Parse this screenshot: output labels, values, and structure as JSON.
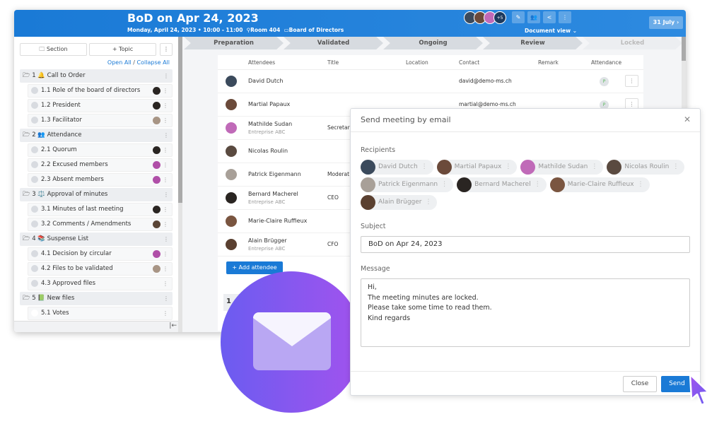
{
  "header": {
    "title": "BoD on Apr 24, 2023",
    "datetime": "Monday, April 24, 2023 • 10:00 - 11:00",
    "location": "Room 404",
    "group": "Board of Directors",
    "more_count": "+5",
    "document_view": "Document view",
    "next_date": "31 July",
    "avatar_colors": [
      "#3b4a5c",
      "#6b4a3a",
      "#c06ab8"
    ]
  },
  "sidebar": {
    "section_btn": "Section",
    "topic_btn": "+ Topic",
    "open_all": "Open All",
    "collapse_all": "Collapse All",
    "sections": [
      {
        "label": "1 🔔 Call to Order",
        "items": [
          {
            "label": "1.1 Role of the board of directors",
            "av": "#2a2522"
          },
          {
            "label": "1.2 President",
            "av": "#2a2522"
          },
          {
            "label": "1.3 Facilitator",
            "av": "#a89585"
          }
        ]
      },
      {
        "label": "2 👥 Attendance",
        "items": [
          {
            "label": "2.1 Quorum",
            "av": "#2a2522"
          },
          {
            "label": "2.2 Excused members",
            "av": "#b04fa8"
          },
          {
            "label": "2.3 Absent members",
            "av": "#b04fa8"
          }
        ]
      },
      {
        "label": "3 ⚖️ Approval of minutes",
        "items": [
          {
            "label": "3.1 Minutes of last meeting",
            "av": "#2a2522"
          },
          {
            "label": "3.2 Comments / Amendments",
            "av": "#5a4536"
          }
        ]
      },
      {
        "label": "4 📚 Suspense List",
        "items": [
          {
            "label": "4.1 Decision by circular",
            "av": "#b04fa8"
          },
          {
            "label": "4.2 Files to be validated",
            "av": "#a89585"
          },
          {
            "label": "4.3 Approved files",
            "av": ""
          }
        ]
      },
      {
        "label": "5 📗 New files",
        "items": [
          {
            "label": "5.1 Votes",
            "av": ""
          }
        ]
      }
    ]
  },
  "stepper": [
    "Preparation",
    "Validated",
    "Ongoing",
    "Review",
    "Locked"
  ],
  "table": {
    "headers": [
      "Attendees",
      "Title",
      "Location",
      "Contact",
      "Remark",
      "Attendance"
    ],
    "rows": [
      {
        "name": "David Dutch",
        "company": "",
        "title": "",
        "contact": "david@demo-ms.ch",
        "attendance": "P",
        "av": "#3b4a5c"
      },
      {
        "name": "Martial Papaux",
        "company": "",
        "title": "",
        "contact": "martial@demo-ms.ch",
        "attendance": "P",
        "av": "#6b4a3a"
      },
      {
        "name": "Mathilde Sudan",
        "company": "Entreprise ABC",
        "title": "Secretar",
        "contact": "",
        "attendance": "",
        "av": "#c06ab8"
      },
      {
        "name": "Nicolas Roulin",
        "company": "",
        "title": "",
        "contact": "",
        "attendance": "",
        "av": "#5a4a40"
      },
      {
        "name": "Patrick Eigenmann",
        "company": "",
        "title": "Moderat",
        "contact": "",
        "attendance": "",
        "av": "#a8a098"
      },
      {
        "name": "Bernard Macherel",
        "company": "Entreprise ABC",
        "title": "CEO",
        "contact": "",
        "attendance": "",
        "av": "#2a2522"
      },
      {
        "name": "Marie-Claire Ruffieux",
        "company": "",
        "title": "",
        "contact": "",
        "attendance": "",
        "av": "#7a5540"
      },
      {
        "name": "Alain Brügger",
        "company": "Entreprise ABC",
        "title": "CFO",
        "contact": "",
        "attendance": "",
        "av": "#5a4030"
      }
    ],
    "add_attendee": "+ Add attendee"
  },
  "modal": {
    "title": "Send meeting by email",
    "recipients_label": "Recipients",
    "recipients": [
      {
        "name": "David Dutch",
        "av": "#3b4a5c"
      },
      {
        "name": "Martial Papaux",
        "av": "#6b4a3a"
      },
      {
        "name": "Mathilde Sudan",
        "av": "#c06ab8"
      },
      {
        "name": "Nicolas Roulin",
        "av": "#5a4a40"
      },
      {
        "name": "Patrick Eigenmann",
        "av": "#a8a098"
      },
      {
        "name": "Bernard Macherel",
        "av": "#2a2522"
      },
      {
        "name": "Marie-Claire Ruffieux",
        "av": "#7a5540"
      },
      {
        "name": "Alain Brügger",
        "av": "#5a4030"
      }
    ],
    "subject_label": "Subject",
    "subject": "BoD on Apr 24, 2023",
    "message_label": "Message",
    "message": "Hi,\nThe meeting minutes are locked.\nPlease take some time to read them.\nKind regards",
    "close": "Close",
    "send": "Send"
  },
  "colors": {
    "primary": "#1a7ad6",
    "envelope_gradient": [
      "#6b5cf0",
      "#a253ee"
    ]
  }
}
